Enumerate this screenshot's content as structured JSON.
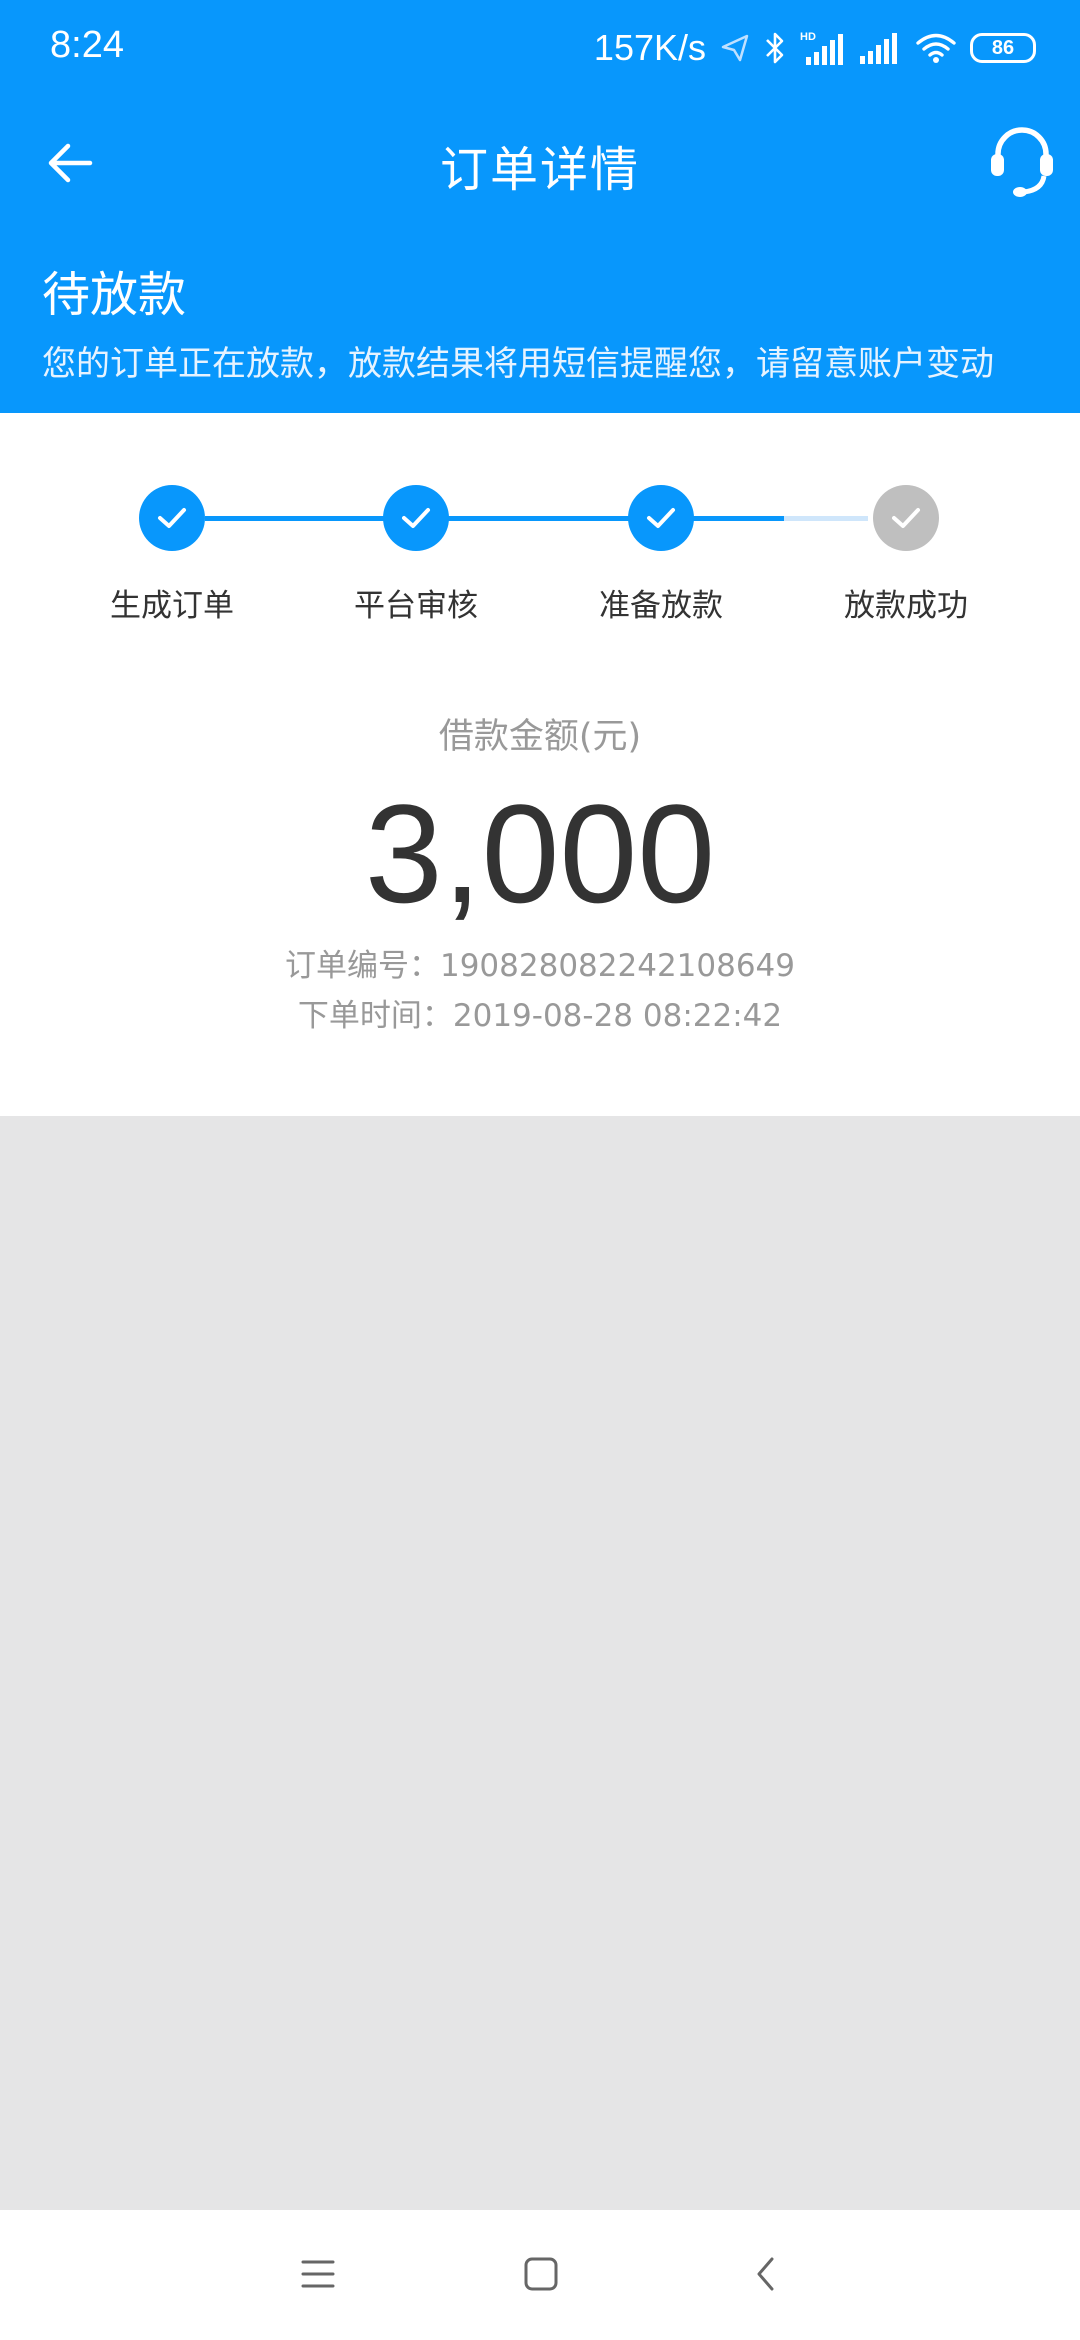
{
  "status_bar": {
    "time": "8:24",
    "speed": "157K/s",
    "battery": "86"
  },
  "nav": {
    "title": "订单详情",
    "back_icon": "arrow-left-icon",
    "support_icon": "headset-icon"
  },
  "order_status": {
    "title": "待放款",
    "description": "您的订单正在放款，放款结果将用短信提醒您，请留意账户变动"
  },
  "steps": [
    {
      "label": "生成订单",
      "done": true
    },
    {
      "label": "平台审核",
      "done": true
    },
    {
      "label": "准备放款",
      "done": true
    },
    {
      "label": "放款成功",
      "done": false
    }
  ],
  "loan": {
    "amount_label": "借款金额(元)",
    "amount": "3,000",
    "order_no": "订单编号：19082808224210864​9",
    "order_time": "下单时间：2019-08-28 08:22:42"
  },
  "colors": {
    "primary": "#0897fc",
    "step_pending": "#bfbfbf",
    "line_pending": "#cfe6fb",
    "page_bg": "#e5e5e6"
  },
  "system_nav": {
    "menu_icon": "menu-icon",
    "home_icon": "home-icon",
    "back_icon": "back-chevron-icon"
  }
}
